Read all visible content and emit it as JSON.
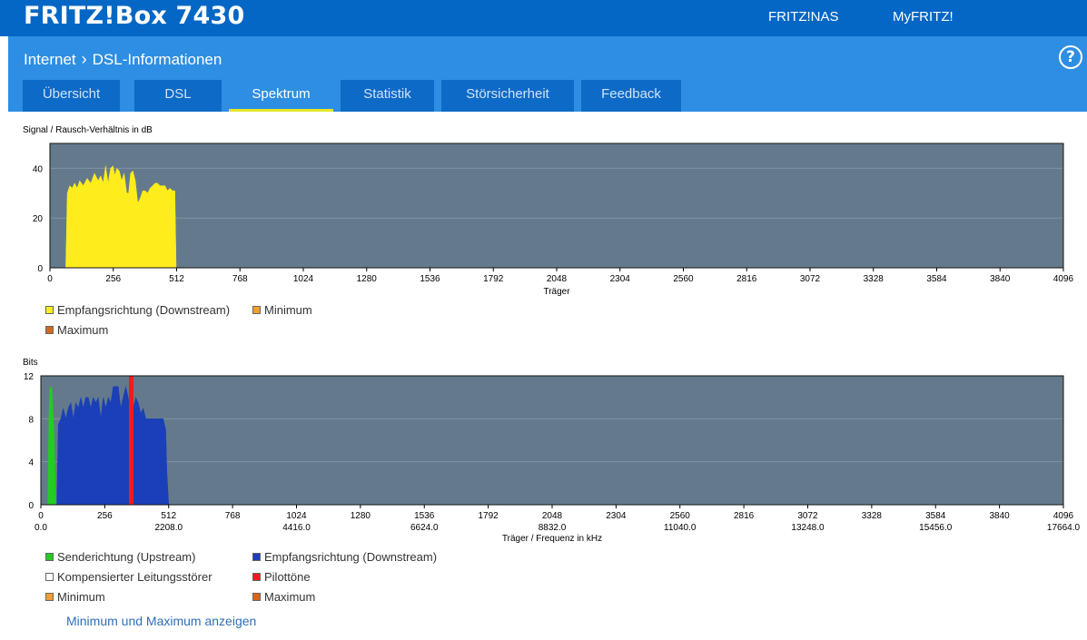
{
  "header": {
    "brand": "FRITZ!Box 7430",
    "links": [
      "FRITZ!NAS",
      "MyFRITZ!"
    ]
  },
  "breadcrumb": {
    "parent": "Internet",
    "current": "DSL-Informationen"
  },
  "help_label": "?",
  "tabs": [
    {
      "label": "Übersicht",
      "active": false
    },
    {
      "label": "DSL",
      "active": false
    },
    {
      "label": "Spektrum",
      "active": true
    },
    {
      "label": "Statistik",
      "active": false
    },
    {
      "label": "Störsicherheit",
      "active": false
    },
    {
      "label": "Feedback",
      "active": false
    }
  ],
  "chart_data": [
    {
      "type": "area",
      "ylabel": "Signal / Rausch-Verhältnis in dB",
      "xlabel": "Träger",
      "ylim": [
        0,
        50
      ],
      "xlim": [
        0,
        4096
      ],
      "yticks": [
        0,
        20,
        40
      ],
      "xticks": [
        0,
        256,
        512,
        768,
        1024,
        1280,
        1536,
        1792,
        2048,
        2304,
        2560,
        2816,
        3072,
        3328,
        3584,
        3840,
        4096
      ],
      "grid": true,
      "series": [
        {
          "name": "Empfangsrichtung (Downstream)",
          "color": "#ffec1c",
          "x": [
            64,
            70,
            80,
            90,
            100,
            110,
            120,
            135,
            150,
            165,
            180,
            195,
            205,
            215,
            225,
            235,
            245,
            255,
            262,
            270,
            280,
            290,
            300,
            310,
            318,
            326,
            335,
            345,
            355,
            365,
            375,
            385,
            395,
            405,
            415,
            425,
            435,
            445,
            455,
            465,
            475,
            485,
            495,
            505,
            510
          ],
          "y": [
            0,
            30,
            33,
            32,
            34,
            32,
            35,
            33,
            36,
            34,
            38,
            35,
            37,
            34,
            41,
            34,
            40,
            41,
            37,
            40,
            39,
            35,
            38,
            30,
            30,
            38,
            39,
            35,
            26,
            28,
            31,
            31,
            30,
            32,
            33,
            34,
            34,
            33,
            33,
            33,
            31,
            32,
            31,
            31,
            0
          ]
        },
        {
          "name": "Minimum",
          "color": "#f0a030",
          "x": [],
          "y": []
        },
        {
          "name": "Maximum",
          "color": "#d2691e",
          "x": [],
          "y": []
        }
      ],
      "legend": [
        "Empfangsrichtung (Downstream)",
        "Minimum",
        "Maximum"
      ]
    },
    {
      "type": "area",
      "ylabel": "Bits",
      "xlabel": "Träger / Frequenz in kHz",
      "ylim": [
        0,
        12
      ],
      "xlim": [
        0,
        4096
      ],
      "yticks": [
        0,
        4,
        8,
        12
      ],
      "xticks": [
        0,
        256,
        512,
        768,
        1024,
        1280,
        1536,
        1792,
        2048,
        2304,
        2560,
        2816,
        3072,
        3328,
        3584,
        3840,
        4096
      ],
      "freq_ticks": [
        "0.0",
        "2208.0",
        "4416.0",
        "6624.0",
        "8832.0",
        "11040.0",
        "13248.0",
        "15456.0",
        "17664.0"
      ],
      "grid": true,
      "series": [
        {
          "name": "Senderichtung (Upstream)",
          "color": "#22cc22",
          "x": [
            28,
            32,
            36,
            40,
            44,
            48,
            52,
            56,
            60
          ],
          "y": [
            0,
            8,
            10.8,
            11,
            10.8,
            9,
            7,
            4,
            0
          ]
        },
        {
          "name": "Empfangsrichtung (Downstream)",
          "color": "#1a3fb8",
          "x": [
            64,
            70,
            80,
            90,
            100,
            110,
            120,
            130,
            140,
            150,
            160,
            170,
            180,
            190,
            200,
            210,
            220,
            230,
            240,
            250,
            260,
            270,
            280,
            290,
            300,
            310,
            320,
            330,
            340,
            350,
            360,
            370,
            380,
            390,
            400,
            410,
            420,
            430,
            440,
            450,
            460,
            470,
            480,
            490,
            500,
            505,
            512
          ],
          "y": [
            0,
            7.5,
            8,
            9,
            8,
            9,
            9.5,
            8,
            9.5,
            9,
            10,
            9,
            10,
            10,
            9,
            10,
            9.5,
            10,
            8,
            10,
            9,
            10,
            9.5,
            11,
            11,
            11,
            9,
            10,
            11,
            10,
            8,
            9,
            10,
            9.5,
            8.5,
            9,
            8,
            8,
            8,
            8,
            8,
            8,
            8,
            8,
            7,
            3,
            0
          ]
        },
        {
          "name": "Kompensierter Leitungsstörer",
          "color": "#ffffff",
          "x": [],
          "y": []
        },
        {
          "name": "Pilottöne",
          "color": "#ee1c1c",
          "x": [
            360
          ],
          "y": [
            12
          ]
        },
        {
          "name": "Minimum",
          "color": "#f0a030",
          "x": [],
          "y": []
        },
        {
          "name": "Maximum",
          "color": "#d2691e",
          "x": [],
          "y": []
        }
      ],
      "legend": [
        "Senderichtung (Upstream)",
        "Empfangsrichtung (Downstream)",
        "Kompensierter Leitungsstörer",
        "Pilottöne",
        "Minimum",
        "Maximum"
      ]
    }
  ],
  "minmax_link": "Minimum und Maximum anzeigen"
}
